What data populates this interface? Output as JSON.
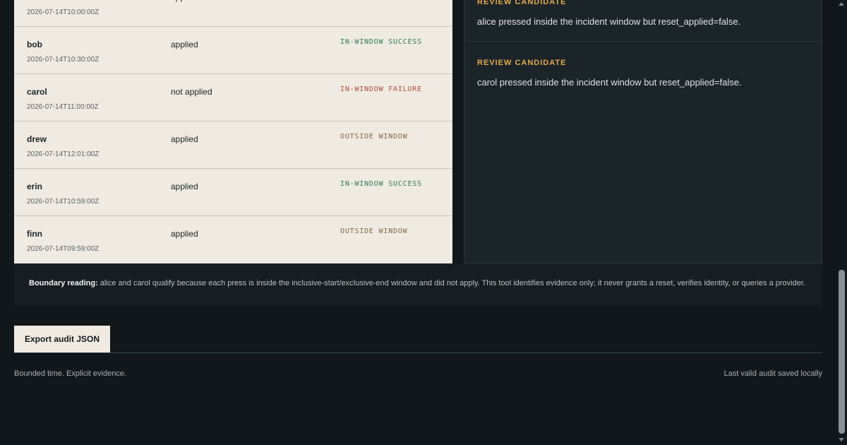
{
  "audit_rows": [
    {
      "user": "",
      "applied": "applied",
      "timestamp": "2026-07-14T10:00:00Z",
      "status": "",
      "kind": "success"
    },
    {
      "user": "bob",
      "applied": "applied",
      "timestamp": "2026-07-14T10:30:00Z",
      "status": "IN-WINDOW SUCCESS",
      "kind": "success"
    },
    {
      "user": "carol",
      "applied": "not applied",
      "timestamp": "2026-07-14T11:00:00Z",
      "status": "IN-WINDOW FAILURE",
      "kind": "failure"
    },
    {
      "user": "drew",
      "applied": "applied",
      "timestamp": "2026-07-14T12:01:00Z",
      "status": "OUTSIDE WINDOW",
      "kind": "outside"
    },
    {
      "user": "erin",
      "applied": "applied",
      "timestamp": "2026-07-14T10:59:00Z",
      "status": "IN-WINDOW SUCCESS",
      "kind": "success"
    },
    {
      "user": "finn",
      "applied": "applied",
      "timestamp": "2026-07-14T09:59:00Z",
      "status": "OUTSIDE WINDOW",
      "kind": "outside"
    }
  ],
  "review": {
    "items": [
      {
        "label": "REVIEW CANDIDATE",
        "text": "alice pressed inside the incident window but reset_applied=false."
      },
      {
        "label": "REVIEW CANDIDATE",
        "text": "carol pressed inside the incident window but reset_applied=false."
      }
    ]
  },
  "boundary": {
    "label": "Boundary reading:",
    "text": " alice and carol qualify because each press is inside the inclusive-start/exclusive-end window and did not apply. This tool identifies evidence only; it never grants a reset, verifies identity, or queries a provider."
  },
  "actions": {
    "export_label": "Export audit JSON"
  },
  "footer": {
    "left": "Bounded time. Explicit evidence.",
    "right": "Last valid audit saved locally"
  },
  "colors": {
    "success": "#2e7a56",
    "failure": "#b24a3a",
    "outside": "#7d6a45",
    "review_label": "#e3a94a"
  }
}
